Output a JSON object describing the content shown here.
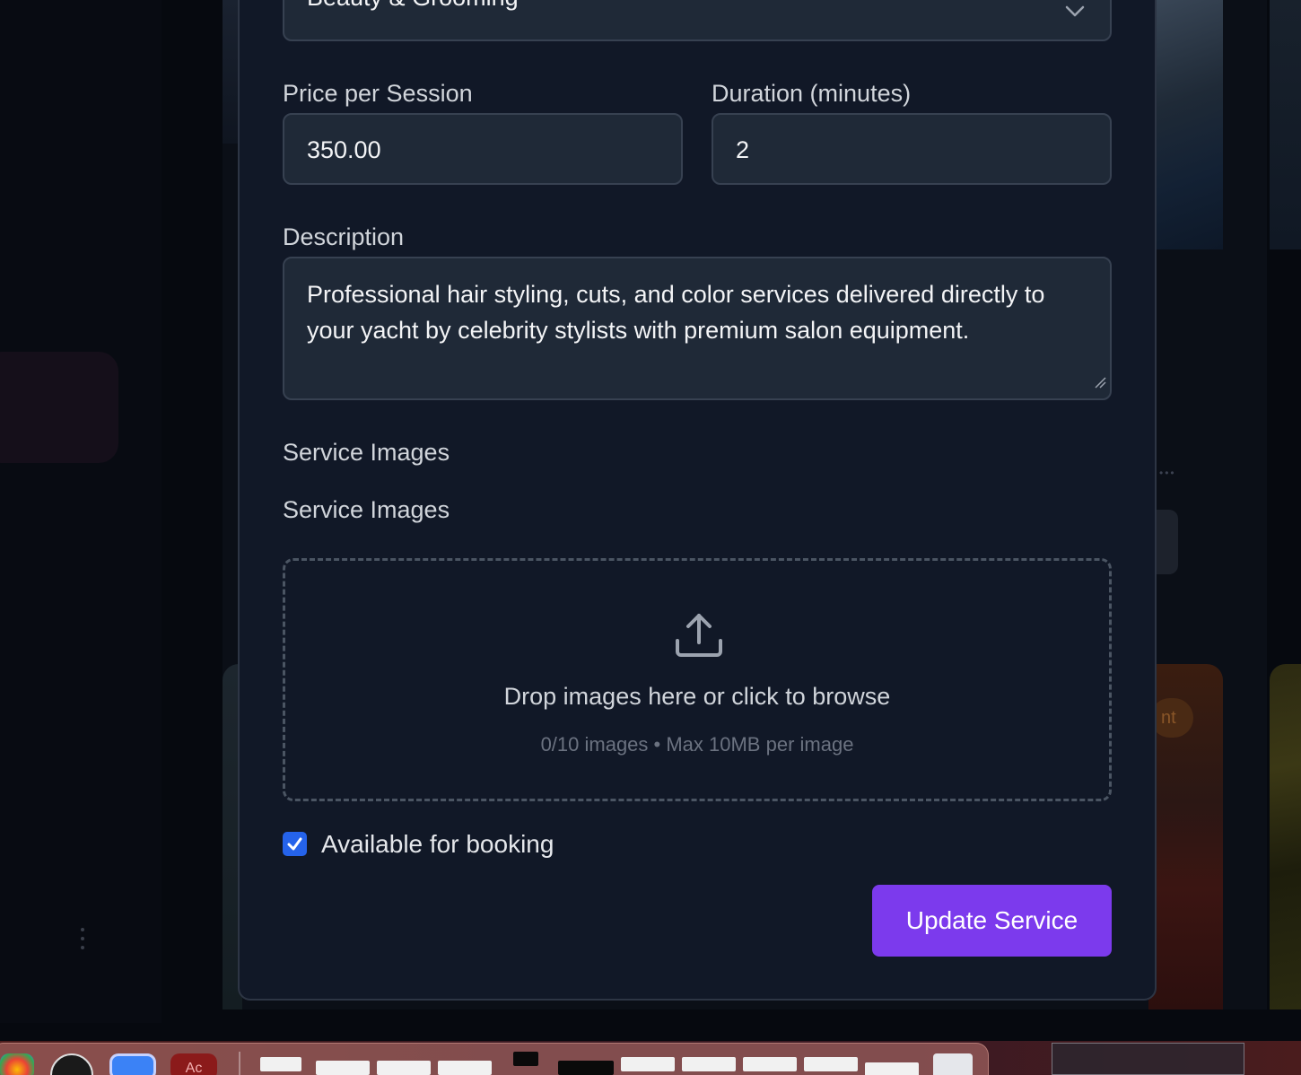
{
  "modal": {
    "category_select": {
      "value": "Beauty & Grooming"
    },
    "price": {
      "label": "Price per Session",
      "value": "350.00"
    },
    "duration": {
      "label": "Duration (minutes)",
      "value": "2"
    },
    "description": {
      "label": "Description",
      "value": "Professional hair styling, cuts, and color services delivered directly to your yacht by celebrity stylists with premium salon equipment."
    },
    "images_section": {
      "heading": "Service Images",
      "sublabel": "Service Images",
      "dropzone_title": "Drop images here or click to browse",
      "dropzone_hint": "0/10 images • Max 10MB per image"
    },
    "available": {
      "label": "Available for booking",
      "checked": true
    },
    "submit_label": "Update Service"
  },
  "colors": {
    "accent_button": "#7c3aed",
    "checkbox": "#2563eb",
    "modal_bg": "#111827",
    "input_bg": "#1f2937"
  },
  "icons": [
    "chevron-down-icon",
    "upload-icon",
    "checkmark-icon",
    "resize-grip-icon"
  ]
}
